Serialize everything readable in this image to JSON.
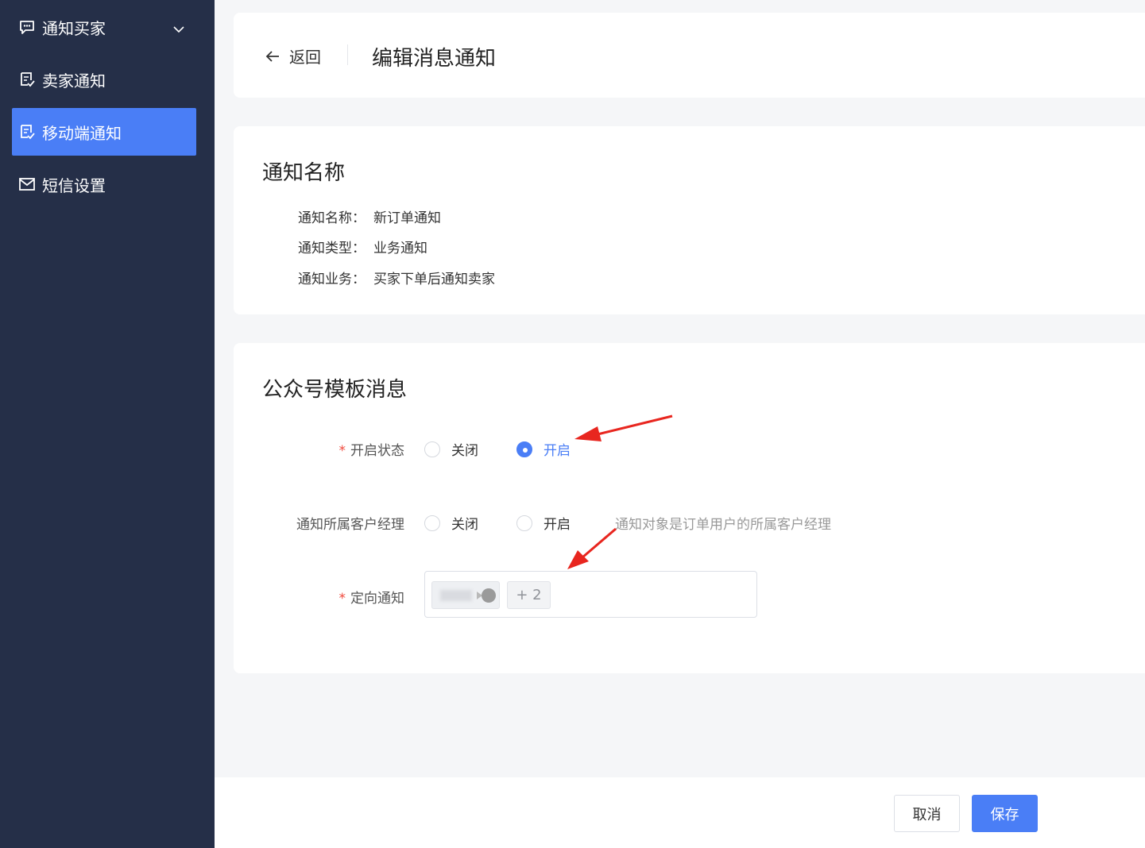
{
  "sidebar": {
    "items": [
      {
        "label": "通知买家",
        "icon": "chat-icon",
        "expandable": true
      },
      {
        "label": "卖家通知",
        "icon": "notice-icon"
      },
      {
        "label": "移动端通知",
        "icon": "notice-icon",
        "active": true
      },
      {
        "label": "短信设置",
        "icon": "mail-icon"
      }
    ]
  },
  "header": {
    "back_label": "返回",
    "title": "编辑消息通知"
  },
  "info": {
    "section_title": "通知名称",
    "rows": [
      {
        "key": "通知名称：",
        "value": "新订单通知"
      },
      {
        "key": "通知类型：",
        "value": "业务通知"
      },
      {
        "key": "通知业务：",
        "value": "买家下单后通知卖家"
      }
    ]
  },
  "message": {
    "section_title": "公众号模板消息",
    "status": {
      "label": "开启状态",
      "required": "*",
      "options": [
        "关闭",
        "开启"
      ],
      "selected": "开启"
    },
    "manager": {
      "label": "通知所属客户经理",
      "options": [
        "关闭",
        "开启"
      ],
      "selected": "",
      "hint": "通知对象是订单用户的所属客户经理"
    },
    "targeted": {
      "label": "定向通知",
      "required": "*",
      "more_tag": "+ 2"
    }
  },
  "footer": {
    "cancel_label": "取消",
    "save_label": "保存"
  },
  "colors": {
    "sidebar_bg": "#252f48",
    "accent": "#4a7ef6",
    "required": "#f04a3e",
    "annotation_arrow": "#e8261f"
  }
}
